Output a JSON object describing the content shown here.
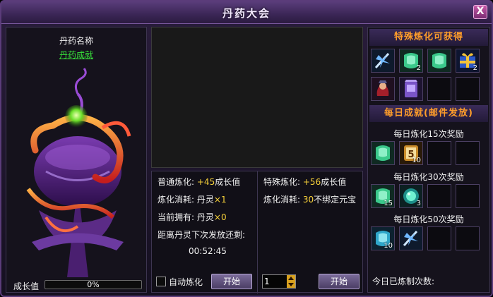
{
  "window": {
    "title": "丹药大会",
    "close_label": "X"
  },
  "left": {
    "pill_name": "丹药名称",
    "pill_achievement": "丹药成就",
    "growth_label": "成长值",
    "growth_percent_text": "0%",
    "growth_value": 0
  },
  "stats": {
    "normal": {
      "label": "普通炼化:",
      "amount": "+45",
      "unit": "成长值"
    },
    "normal_cost": {
      "label": "炼化消耗:",
      "item": "丹灵",
      "qty": "×1"
    },
    "owned": {
      "label": "当前拥有:",
      "item": "丹灵",
      "qty": "×0"
    },
    "next_release": "距离丹灵下次发放还剩:",
    "time": "00:52:45",
    "special": {
      "label": "特殊炼化:",
      "amount": "+56",
      "unit": "成长值"
    },
    "special_cost": {
      "label": "炼化消耗:",
      "qty": "30",
      "item": "不绑定元宝"
    },
    "auto_label": "自动炼化",
    "start_label": "开始",
    "stepper_value": "1"
  },
  "right": {
    "special_header": "特殊炼化可获得",
    "daily_header": "每日成就(邮件发放)",
    "special_items": [
      {
        "icon": "blue-crystal-icon",
        "count": ""
      },
      {
        "icon": "green-jade-icon",
        "count": "2"
      },
      {
        "icon": "green-jade-icon",
        "count": ""
      },
      {
        "icon": "blue-gift-box-icon",
        "count": "2"
      },
      {
        "icon": "red-warrior-icon",
        "count": ""
      },
      {
        "icon": "purple-scroll-icon",
        "count": ""
      },
      {
        "icon": "empty",
        "count": ""
      },
      {
        "icon": "empty",
        "count": ""
      }
    ],
    "rewards": [
      {
        "title": "每日炼化15次奖励",
        "items": [
          {
            "icon": "green-jade-icon",
            "count": ""
          },
          {
            "icon": "gold-token-5-icon",
            "count": "10"
          },
          {
            "icon": "empty",
            "count": ""
          },
          {
            "icon": "empty",
            "count": ""
          }
        ]
      },
      {
        "title": "每日炼化30次奖励",
        "items": [
          {
            "icon": "green-jade-icon",
            "count": "15"
          },
          {
            "icon": "green-orb-icon",
            "count": "3"
          },
          {
            "icon": "empty",
            "count": ""
          },
          {
            "icon": "empty",
            "count": ""
          }
        ]
      },
      {
        "title": "每日炼化50次奖励",
        "items": [
          {
            "icon": "blue-jade-icon",
            "count": "10"
          },
          {
            "icon": "blue-crystal-icon",
            "count": ""
          },
          {
            "icon": "empty",
            "count": ""
          },
          {
            "icon": "empty",
            "count": ""
          }
        ]
      }
    ],
    "today_count_label": "今日已炼制次数:"
  },
  "colors": {
    "accent_orange": "#ff9d2a",
    "highlight_yellow": "#f7d13a",
    "link_green": "#38e33b",
    "frame_purple": "#5b3c7a"
  }
}
